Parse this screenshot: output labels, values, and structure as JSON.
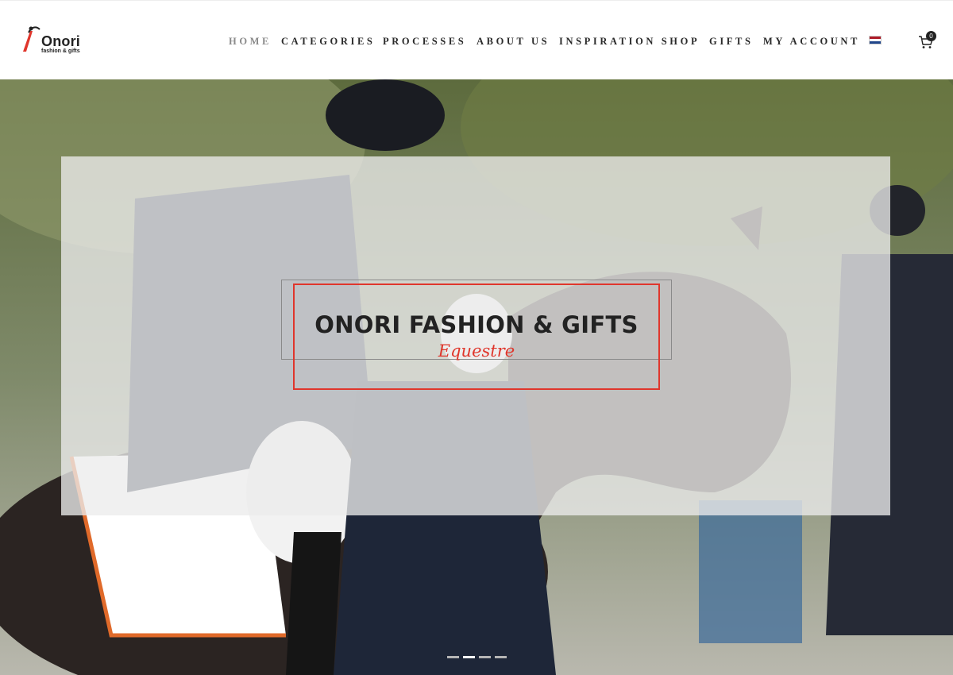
{
  "brand": {
    "name": "Onori",
    "tagline": "fashion & gifts",
    "accent_color": "#e0362c"
  },
  "nav": {
    "items": [
      {
        "label": "HOME",
        "active": true
      },
      {
        "label": "CATEGORIES",
        "active": false
      },
      {
        "label": "PROCESSES",
        "active": false
      },
      {
        "label": "ABOUT US",
        "active": false
      },
      {
        "label": "INSPIRATION SHOP",
        "active": false
      },
      {
        "label": "GIFTS",
        "active": false
      },
      {
        "label": "MY ACCOUNT",
        "active": false
      }
    ],
    "language_flag": "netherlands-flag-icon",
    "cart_icon": "shopping-cart-icon",
    "cart_count": "0"
  },
  "hero": {
    "title": "ONORI FASHION & GIFTS",
    "subtitle": "Equestre",
    "slider": {
      "total": 4,
      "active_index": 1
    }
  }
}
